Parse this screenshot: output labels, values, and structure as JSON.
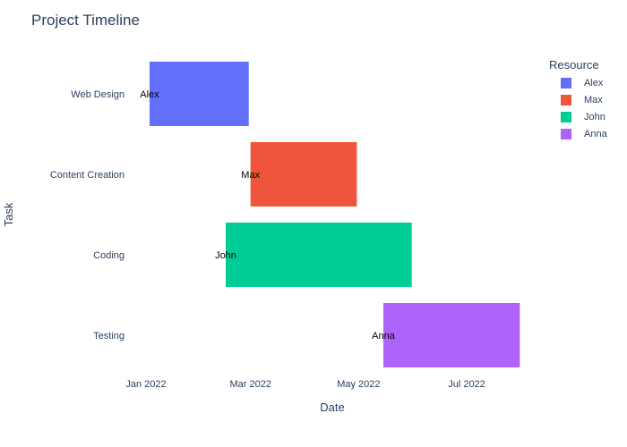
{
  "chart_data": {
    "type": "bar",
    "subtype": "gantt",
    "title": "Project Timeline",
    "xlabel": "Date",
    "ylabel": "Task",
    "x_ticks": [
      "Jan 2022",
      "Mar 2022",
      "May 2022",
      "Jul 2022"
    ],
    "legend": {
      "title": "Resource",
      "placement": "top-right",
      "entries": [
        {
          "name": "Alex",
          "color": "#636efa"
        },
        {
          "name": "Max",
          "color": "#ef553b"
        },
        {
          "name": "John",
          "color": "#00cc96"
        },
        {
          "name": "Anna",
          "color": "#ab63fa"
        }
      ]
    },
    "tasks": [
      {
        "task": "Web Design",
        "resource": "Alex",
        "start": "2022-01-03",
        "end": "2022-02-28",
        "color": "#636efa"
      },
      {
        "task": "Content Creation",
        "resource": "Max",
        "start": "2022-03-01",
        "end": "2022-04-30",
        "color": "#ef553b"
      },
      {
        "task": "Coding",
        "resource": "John",
        "start": "2022-02-15",
        "end": "2022-05-31",
        "color": "#00cc96"
      },
      {
        "task": "Testing",
        "resource": "Anna",
        "start": "2022-05-15",
        "end": "2022-07-31",
        "color": "#ab63fa"
      }
    ],
    "grid": false
  }
}
